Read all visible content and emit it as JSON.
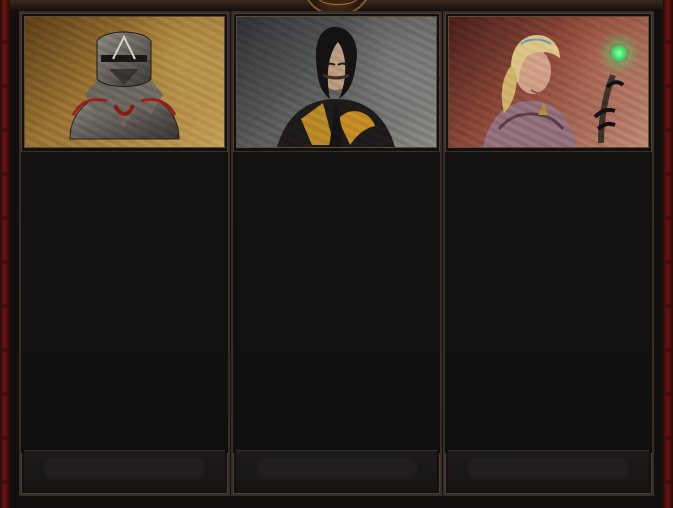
{
  "screen": {
    "panels": [
      {
        "icon": "armored-warrior-portrait"
      },
      {
        "icon": "dark-robed-man-portrait"
      },
      {
        "icon": "sorceress-portrait"
      }
    ],
    "colors": {
      "frame_red": "#6b1612",
      "panel_border": "#362d28",
      "content_bg": "#121110",
      "glow_green": "#36e26e"
    }
  }
}
